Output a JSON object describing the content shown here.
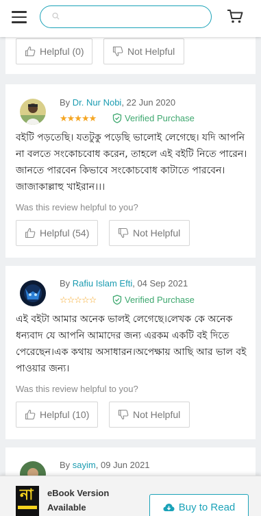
{
  "header": {
    "search_placeholder": "",
    "menu_icon": "hamburger-icon",
    "cart_icon": "cart-icon"
  },
  "review0": {
    "helpful_label": "Helpful (0)",
    "not_helpful_label": "Not Helpful"
  },
  "review1": {
    "by": "By",
    "author": "Dr. Nur Nobi",
    "date": ", 22 Jun 2020",
    "rating": 5,
    "stars": "★★★★★",
    "verified": "Verified Purchase",
    "text": "বইটি পড়তেছি। যতটুকু পড়েছি ভালোই লেগেছে। যদি আপনি না বলতে সংকোচবোধ করেন, তাহলে এই বইটি নিতে পারেন। জানতে পারবেন কিভাবে সংকোচবোধ কাটাতে পারবেন। জাজাকাল্লাহু খাইরান।।।",
    "question": "Was this review helpful to you?",
    "helpful_label": "Helpful (54)",
    "not_helpful_label": "Not Helpful"
  },
  "review2": {
    "by": "By",
    "author": "Rafiu Islam Efti",
    "date": ", 04 Sep 2021",
    "rating": 0,
    "stars": "☆☆☆☆☆",
    "verified": "Verified Purchase",
    "text": "এই বইটা আমার অনেক ভালই লেগেছে।লেখক কে অনেক ধন্যবাদ যে আপনি আমাদের জন্য এরকম একটি বই দিতে পেরেছেন।এক কথায় অসাধারন।অপেক্ষায় আছি আর ভাল বই পাওয়ার জন্য।",
    "question": "Was this review helpful to you?",
    "helpful_label": "Helpful (10)",
    "not_helpful_label": "Not Helpful"
  },
  "review3": {
    "by": "By",
    "author": "sayim",
    "date": ", 09 Jun 2021"
  },
  "ebook": {
    "cover_char": "না",
    "title": "eBook Version Available",
    "button_label": "Buy to Read"
  },
  "colors": {
    "accent": "#1aa2b8",
    "star": "#f5a623",
    "verified": "#3ea86f"
  }
}
